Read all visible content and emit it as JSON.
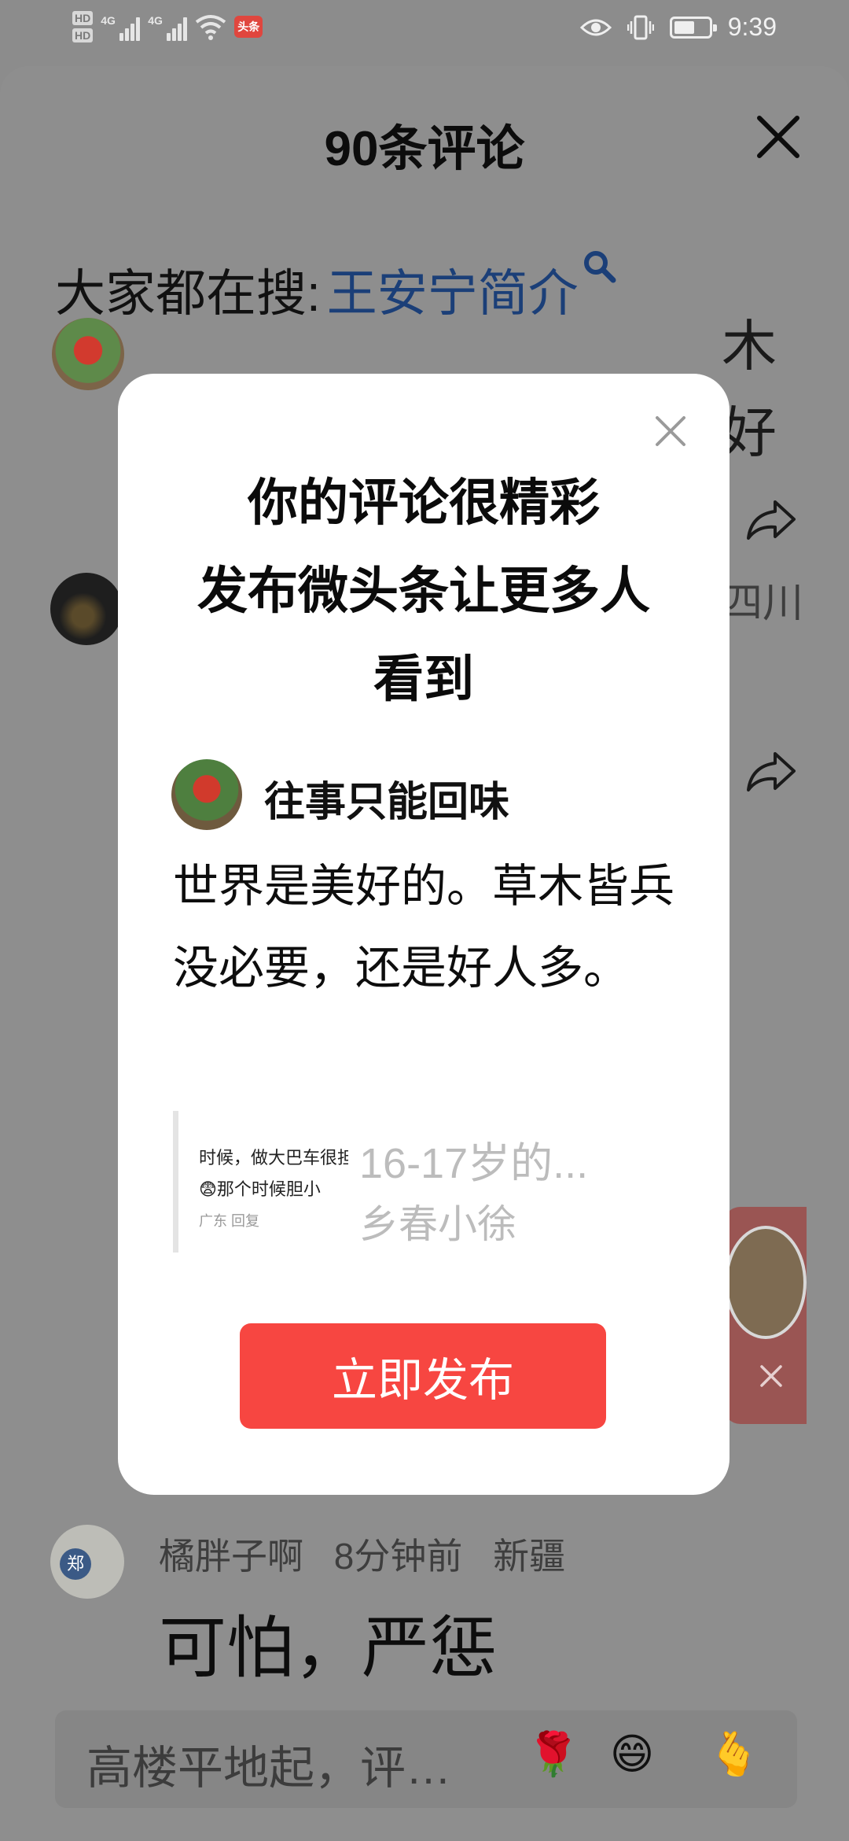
{
  "status_bar": {
    "hd1": "HD",
    "hd2": "HD",
    "net1": "4G",
    "net2": "4G",
    "app_badge": "头条",
    "battery_level": 0.6,
    "time": "9:39",
    "icons": [
      "signal-icon",
      "wifi-icon",
      "eye-icon",
      "vibrate-icon",
      "battery-icon"
    ]
  },
  "sheet": {
    "title": "90条评论",
    "search_prefix": "大家都在搜:",
    "search_term": "王安宁简介"
  },
  "background_fragments": {
    "line1": "木",
    "line2": "好",
    "location": "四川"
  },
  "last_comment": {
    "avatar_text": "郑",
    "user": "橘胖子啊",
    "time": "8分钟前",
    "location": "新疆",
    "text": "可怕，严惩"
  },
  "input": {
    "placeholder": "高楼平地起，评…",
    "emojis": [
      "🌹",
      "😄",
      "🫰"
    ]
  },
  "modal": {
    "title_line1": "你的评论很精彩",
    "title_line2": "发布微头条让更多人",
    "title_line3": "看到",
    "user_name": "往事只能回味",
    "comment": "世界是美好的。草木皆兵没必要，还是好人多。",
    "quote": {
      "thumb_line1": "时候，做大巴车很担",
      "thumb_line2": "😨那个时候胆小",
      "thumb_meta": "广东   回复",
      "title": "16-17岁的...",
      "author": "乡春小徐"
    },
    "publish_label": "立即发布"
  },
  "colors": {
    "overlay": "#8c8c8c",
    "accent_red": "#f74641",
    "link_blue": "#1b3f78"
  }
}
